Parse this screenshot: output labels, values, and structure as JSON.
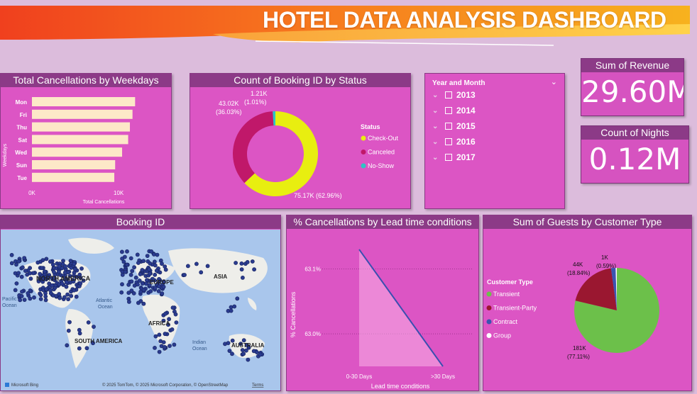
{
  "banner": {
    "title": "HOTEL DATA ANALYSIS DASHBOARD"
  },
  "weekdays_chart": {
    "title": "Total Cancellations by Weekdays",
    "chart_data": {
      "type": "bar",
      "orientation": "horizontal",
      "categories": [
        "Mon",
        "Fri",
        "Thu",
        "Sat",
        "Wed",
        "Sun",
        "Tue"
      ],
      "values": [
        11900,
        11600,
        11300,
        11100,
        10400,
        9600,
        9500
      ],
      "xlabel": "Total Cancellations",
      "ylabel": "Weekdays",
      "xticks": [
        "0K",
        "10K"
      ],
      "xlim": [
        0,
        14000
      ],
      "bar_color": "#fde8c8"
    }
  },
  "status_chart": {
    "title": "Count of Booking ID by Status",
    "legend_title": "Status",
    "chart_data": {
      "type": "pie",
      "donut": true,
      "labels": [
        "Check-Out",
        "Canceled",
        "No-Show"
      ],
      "values": [
        75170,
        43020,
        1210
      ],
      "colors": [
        "#e8ee10",
        "#c0186a",
        "#2ec4c4"
      ],
      "data_labels": [
        {
          "value": "75.17K",
          "percent": "(62.96%)"
        },
        {
          "value": "43.02K",
          "percent": "(36.03%)"
        },
        {
          "value": "1.21K",
          "percent": "(1.01%)"
        }
      ]
    }
  },
  "slicer": {
    "title": "Year and Month",
    "items": [
      "2013",
      "2014",
      "2015",
      "2016",
      "2017"
    ]
  },
  "kpis": [
    {
      "label": "Sum of Revenue",
      "value": "29.60M"
    },
    {
      "label": "Count of Nights",
      "value": "0.12M"
    }
  ],
  "map": {
    "title": "Booking ID",
    "labels": {
      "north_america": "NORTH AMERICA",
      "europe": "EUROPE",
      "asia": "ASIA",
      "africa": "AFRICA",
      "south_america": "SOUTH AMERICA",
      "australia": "AUSTRALIA",
      "pacific": "Pacific",
      "pacific2": "Ocean",
      "atlantic": "Atlantic",
      "atlantic2": "Ocean",
      "indian": "Indian",
      "indian2": "Ocean"
    },
    "logo": "Microsoft Bing",
    "attribution": "© 2025 TomTom, © 2025 Microsoft Corporation, © OpenStreetMap",
    "terms": "Terms"
  },
  "lead_chart": {
    "title": "% Cancellations by Lead time conditions",
    "chart_data": {
      "type": "line",
      "categories": [
        "0-30 Days",
        ">30 Days"
      ],
      "values": [
        63.13,
        62.95
      ],
      "yticks": [
        "63.1%",
        "63.0%"
      ],
      "ylabel": "% Cancellations",
      "xlabel": "Lead time conditions",
      "line_color": "#3a4fb0"
    }
  },
  "guests_chart": {
    "title": "Sum of Guests by Customer Type",
    "legend_title": "Customer Type",
    "chart_data": {
      "type": "pie",
      "labels": [
        "Transient",
        "Transient-Party",
        "Contract",
        "Group"
      ],
      "values": [
        181000,
        44000,
        4000,
        1000
      ],
      "colors": [
        "#6cc04a",
        "#9a1730",
        "#3a55b0",
        "#ffffff"
      ],
      "data_labels": [
        {
          "value": "181K",
          "percent": "(77.11%)"
        },
        {
          "value": "44K",
          "percent": "(18.84%)"
        },
        {
          "value": "1K",
          "percent": "(0.59%)"
        }
      ]
    }
  }
}
